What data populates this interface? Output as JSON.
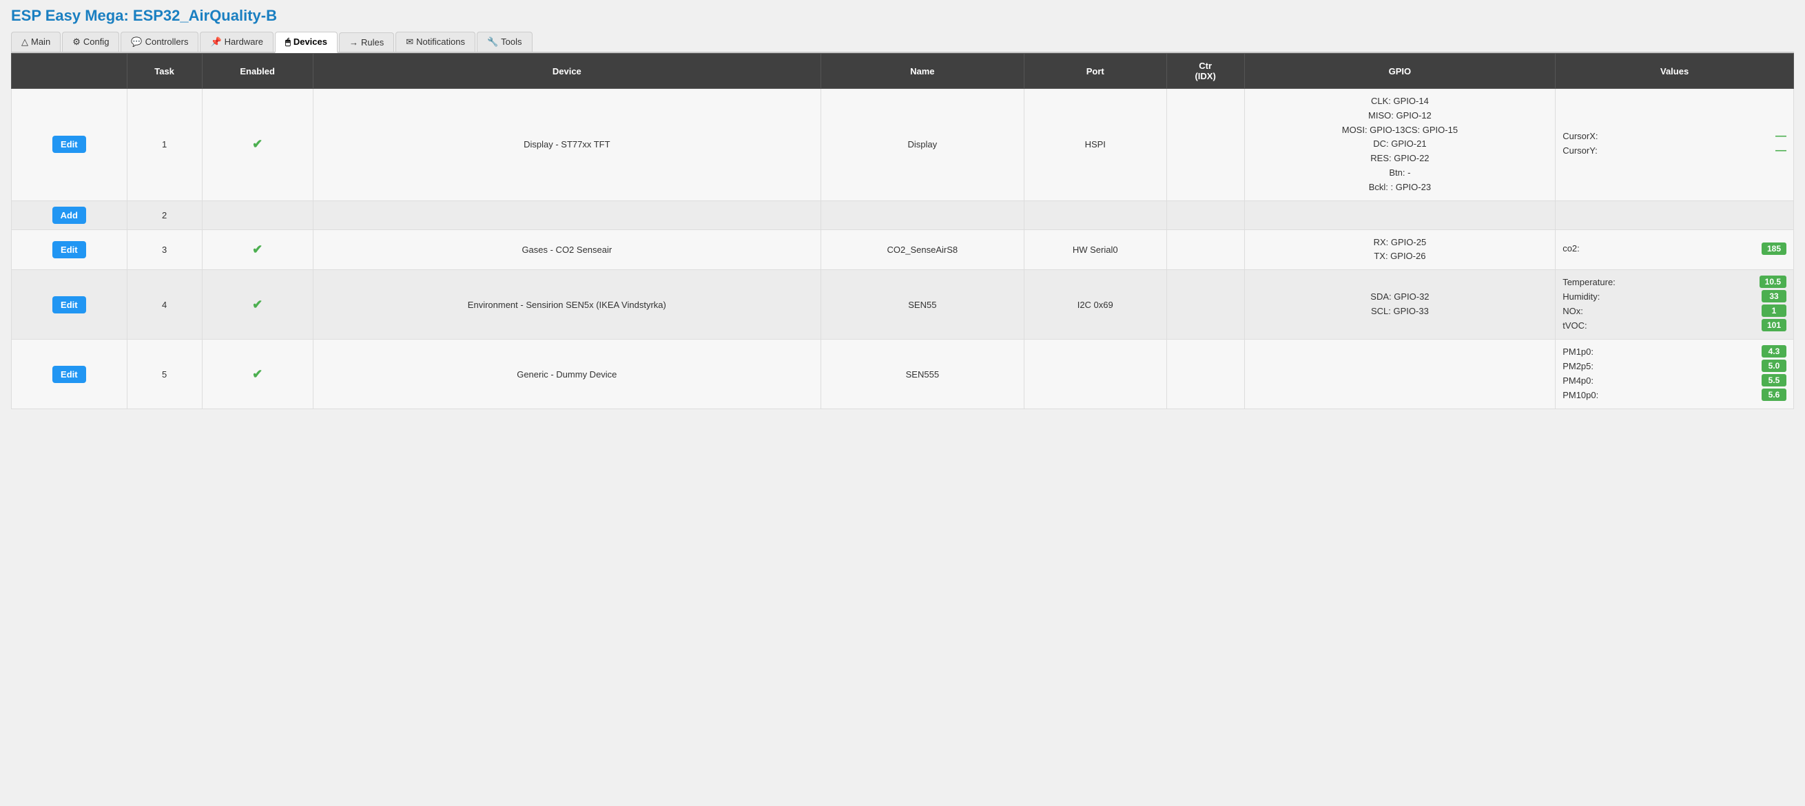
{
  "app": {
    "title": "ESP Easy Mega: ESP32_AirQuality-B"
  },
  "nav": {
    "tabs": [
      {
        "id": "main",
        "icon": "△",
        "label": "Main",
        "active": false
      },
      {
        "id": "config",
        "icon": "⚙",
        "label": "Config",
        "active": false
      },
      {
        "id": "controllers",
        "icon": "💬",
        "label": "Controllers",
        "active": false
      },
      {
        "id": "hardware",
        "icon": "📌",
        "label": "Hardware",
        "active": false
      },
      {
        "id": "devices",
        "icon": "🖱",
        "label": "Devices",
        "active": true
      },
      {
        "id": "rules",
        "icon": "→",
        "label": "Rules",
        "active": false
      },
      {
        "id": "notifications",
        "icon": "✉",
        "label": "Notifications",
        "active": false
      },
      {
        "id": "tools",
        "icon": "🔧",
        "label": "Tools",
        "active": false
      }
    ]
  },
  "table": {
    "headers": [
      "",
      "Task",
      "Enabled",
      "Device",
      "Name",
      "Port",
      "Ctr (IDX)",
      "GPIO",
      "Values"
    ],
    "rows": [
      {
        "btn_label": "Edit",
        "task": "1",
        "enabled": true,
        "device": "Display - ST77xx TFT",
        "name": "Display",
        "port": "HSPI",
        "ctr_idx": "",
        "gpio": "CLK: GPIO-14\nMISO: GPIO-12\nMOSI: GPIO-13CS: GPIO-15\nDC: GPIO-21\nRES: GPIO-22\nBtn: -\nBckl: : GPIO-23",
        "values": [
          {
            "label": "CursorX:",
            "value": "—",
            "badge": false
          },
          {
            "label": "CursorY:",
            "value": "—",
            "badge": false
          }
        ]
      },
      {
        "btn_label": "Add",
        "task": "2",
        "enabled": false,
        "device": "",
        "name": "",
        "port": "",
        "ctr_idx": "",
        "gpio": "",
        "values": []
      },
      {
        "btn_label": "Edit",
        "task": "3",
        "enabled": true,
        "device": "Gases - CO2 Senseair",
        "name": "CO2_SenseAirS8",
        "port": "HW Serial0",
        "ctr_idx": "",
        "gpio": "RX: GPIO-25\nTX: GPIO-26",
        "values": [
          {
            "label": "co2:",
            "value": "185",
            "badge": true
          }
        ]
      },
      {
        "btn_label": "Edit",
        "task": "4",
        "enabled": true,
        "device": "Environment - Sensirion SEN5x (IKEA Vindstyrka)",
        "name": "SEN55",
        "port": "I2C 0x69",
        "ctr_idx": "",
        "gpio": "SDA: GPIO-32\nSCL: GPIO-33",
        "values": [
          {
            "label": "Temperature:",
            "value": "10.5",
            "badge": true
          },
          {
            "label": "Humidity:",
            "value": "33",
            "badge": true
          },
          {
            "label": "NOx:",
            "value": "1",
            "badge": true
          },
          {
            "label": "tVOC:",
            "value": "101",
            "badge": true
          }
        ]
      },
      {
        "btn_label": "Edit",
        "task": "5",
        "enabled": true,
        "device": "Generic - Dummy Device",
        "name": "SEN555",
        "port": "",
        "ctr_idx": "",
        "gpio": "",
        "values": [
          {
            "label": "PM1p0:",
            "value": "4.3",
            "badge": true
          },
          {
            "label": "PM2p5:",
            "value": "5.0",
            "badge": true
          },
          {
            "label": "PM4p0:",
            "value": "5.5",
            "badge": true
          },
          {
            "label": "PM10p0:",
            "value": "5.6",
            "badge": true
          }
        ]
      }
    ]
  }
}
